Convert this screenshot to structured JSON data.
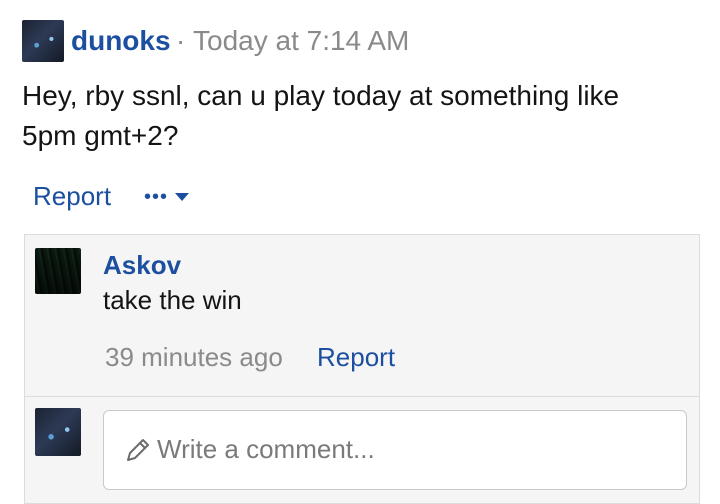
{
  "post": {
    "author": "dunoks",
    "separator": "·",
    "timestamp": "Today at 7:14 AM",
    "text_line1": "Hey, rby ssnl, can u play today at something like",
    "text_line2": "5pm gmt+2?",
    "report_label": "Report",
    "more_label": "•••"
  },
  "reply": {
    "author": "Askov",
    "text": "take the win",
    "timestamp": "39 minutes ago",
    "report_label": "Report"
  },
  "comment_input": {
    "placeholder": "Write a comment..."
  },
  "colors": {
    "link": "#1c4fa0",
    "meta": "#8a8a8a",
    "panel": "#f5f5f5"
  }
}
